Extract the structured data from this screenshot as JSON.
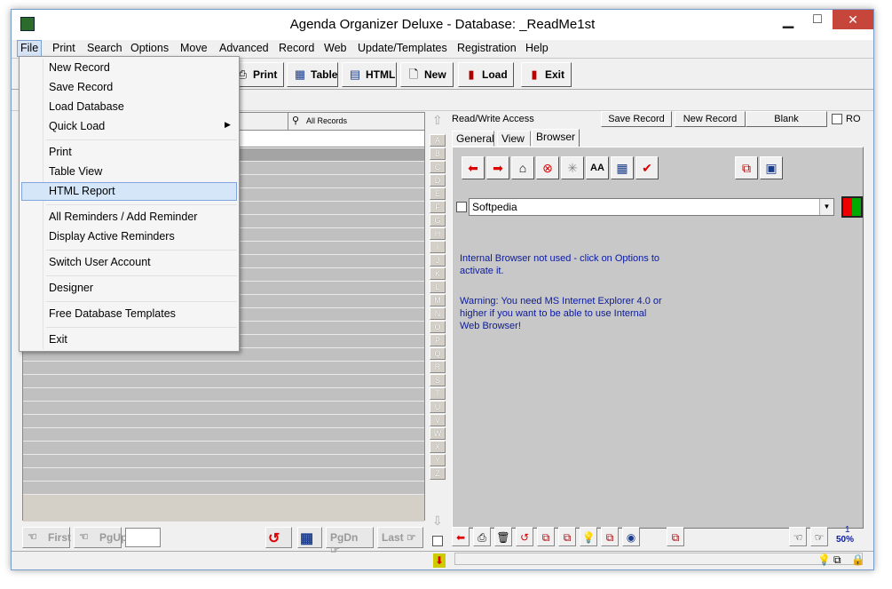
{
  "window": {
    "title": "Agenda Organizer Deluxe - Database: _ReadMe1st",
    "minimize": "▁",
    "maximize": "□",
    "close": "✕"
  },
  "menubar": [
    "File",
    "Print",
    "Search",
    "Options",
    "Move",
    "Advanced",
    "Record",
    "Web",
    "Update/Templates",
    "Registration",
    "Help"
  ],
  "toolbar": {
    "print": "Print",
    "table": "Table",
    "html": "HTML",
    "new": "New",
    "load": "Load",
    "exit": "Exit"
  },
  "left": {
    "all_records": "All Records"
  },
  "alphabet": [
    "A",
    "B",
    "C",
    "D",
    "E",
    "F",
    "G",
    "H",
    "I",
    "J",
    "K",
    "L",
    "M",
    "N",
    "O",
    "P",
    "Q",
    "R",
    "S",
    "T",
    "U",
    "V",
    "W",
    "X",
    "Y",
    "Z"
  ],
  "right": {
    "access": "Read/Write Access",
    "save_record": "Save Record",
    "new_record": "New Record",
    "blank": "Blank",
    "ro": "RO",
    "tabs": [
      "General",
      "View",
      "Browser"
    ],
    "url": "Softpedia",
    "msg1": "Internal Browser not used - click on Options to activate it.",
    "msg2": "Warning: You need MS Internet Explorer 4.0 or higher if you want to be able to use Internal Web Browser!"
  },
  "nav": {
    "first": "First",
    "pgup": "PgUp",
    "pgdn": "PgDn",
    "last": "Last"
  },
  "status": {
    "count": "1",
    "zoom": "50%"
  },
  "file_menu": {
    "items": [
      "New Record",
      "Save Record",
      "Load Database",
      "Quick Load",
      "Print",
      "Table View",
      "HTML Report",
      "All Reminders / Add Reminder",
      "Display Active Reminders",
      "Switch User Account",
      "Designer",
      "Free Database Templates",
      "Exit"
    ],
    "highlighted": "HTML Report"
  },
  "colors": {
    "highlight": "#d5e6f9",
    "message": "#0a1aa0",
    "close": "#c7463b"
  }
}
